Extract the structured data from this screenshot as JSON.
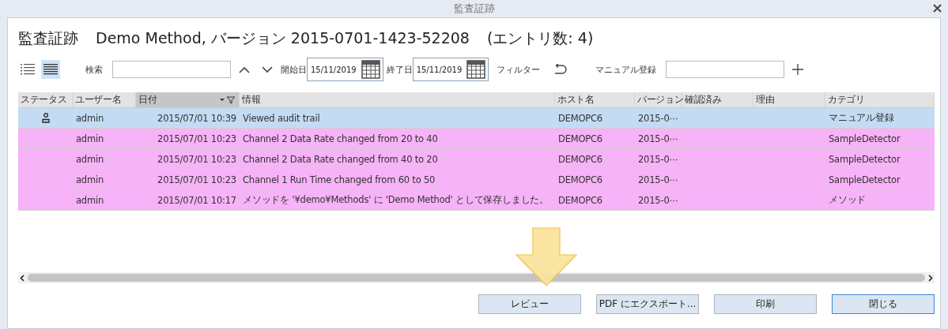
{
  "window": {
    "title": "監査証跡"
  },
  "heading": {
    "title": "監査証跡",
    "subtitle": "Demo Method, バージョン 2015-0701-1423-52208",
    "count": "(エントリ数: 4)"
  },
  "toolbar": {
    "views": [
      {
        "selected": false
      },
      {
        "selected": true
      }
    ],
    "search_label": "検索",
    "start_label": "開始日",
    "start_date": "15/11/2019",
    "end_label": "終了日",
    "end_date": "15/11/2019",
    "filter_label": "フィルター",
    "manual_label": "マニュアル登録"
  },
  "table": {
    "columns": [
      {
        "label": "ステータス",
        "sorted": false
      },
      {
        "label": "ユーザー名",
        "sorted": false
      },
      {
        "label": "日付",
        "sorted": true
      },
      {
        "label": "情報",
        "sorted": false
      },
      {
        "label": "ホスト名",
        "sorted": false
      },
      {
        "label": "バージョン",
        "sorted": false
      },
      {
        "label": "確認済み",
        "sorted": false
      },
      {
        "label": "理由",
        "sorted": false
      },
      {
        "label": "カテゴリ",
        "sorted": false
      }
    ],
    "rows": [
      {
        "selected": true,
        "user_icon": true,
        "user": "admin",
        "date": "2015/07/01 10:39",
        "info": "Viewed audit trail",
        "host": "DEMOPC6",
        "version": "2015-0⋯",
        "category": "マニュアル登録"
      },
      {
        "selected": false,
        "user_icon": false,
        "user": "admin",
        "date": "2015/07/01 10:23",
        "info": "Channel 2 Data Rate changed from 20 to 40",
        "host": "DEMOPC6",
        "version": "2015-0⋯",
        "category": "SampleDetector"
      },
      {
        "selected": false,
        "user_icon": false,
        "user": "admin",
        "date": "2015/07/01 10:23",
        "info": "Channel 2 Data Rate changed from 40 to 20",
        "host": "DEMOPC6",
        "version": "2015-0⋯",
        "category": "SampleDetector"
      },
      {
        "selected": false,
        "user_icon": false,
        "user": "admin",
        "date": "2015/07/01 10:23",
        "info": "Channel 1 Run Time changed from 60 to 50",
        "host": "DEMOPC6",
        "version": "2015-0⋯",
        "category": "SampleDetector"
      },
      {
        "selected": false,
        "user_icon": false,
        "user": "admin",
        "date": "2015/07/01 10:17",
        "info": "メソッドを '¥demo¥Methods' に 'Demo Method' として保存しました。",
        "host": "DEMOPC6",
        "version": "2015-0⋯",
        "category": "メソッド"
      }
    ]
  },
  "buttons": [
    {
      "label": "レビュー",
      "default": false
    },
    {
      "label": "PDF にエクスポート...",
      "default": false
    },
    {
      "label": "印刷",
      "default": false
    },
    {
      "label": "閉じる",
      "default": true
    }
  ]
}
